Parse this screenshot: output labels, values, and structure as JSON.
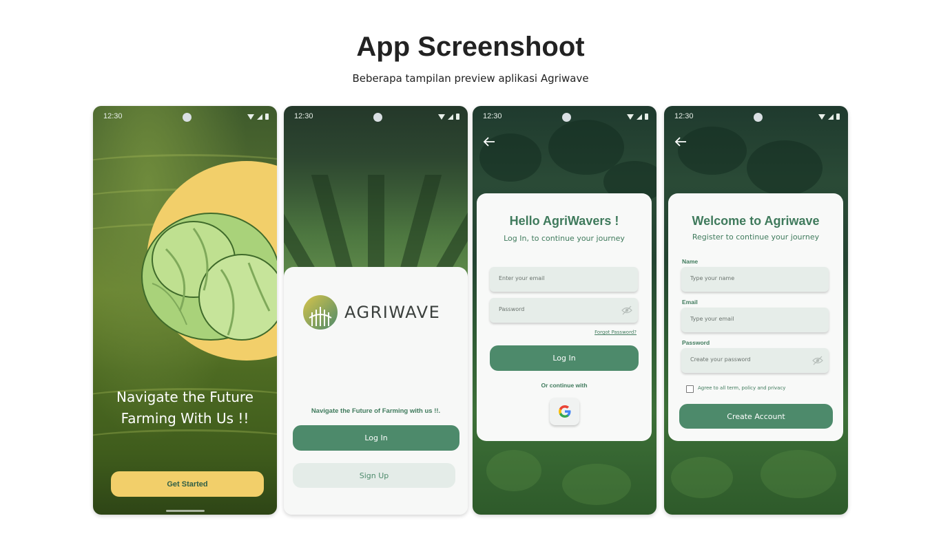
{
  "header": {
    "title": "App Screenshoot",
    "subtitle": "Beberapa tampilan preview aplikasi Agriwave"
  },
  "status_bar": {
    "time": "12:30"
  },
  "screen1": {
    "headline_line1": "Navigate the Future",
    "headline_line2": "Farming With Us !!",
    "get_started": "Get Started"
  },
  "screen2": {
    "logo_text": "AGRIWAVE",
    "tagline": "Navigate the Future of Farming with us !!.",
    "login": "Log In",
    "signup": "Sign Up"
  },
  "screen3": {
    "title": "Hello AgriWavers !",
    "subtitle": "Log In, to continue your journey",
    "email_placeholder": "Enter your email",
    "password_placeholder": "Password",
    "forgot_password": "Forgot Password?",
    "login": "Log In",
    "or_continue": "Or continue with"
  },
  "screen4": {
    "title": "Welcome to Agriwave",
    "subtitle": "Register to continue your journey",
    "name_label": "Name",
    "name_placeholder": "Type your name",
    "email_label": "Email",
    "email_placeholder": "Type your email",
    "password_label": "Password",
    "password_placeholder": "Create your password",
    "agree": "Agree to all term, policy and privacy",
    "create_account": "Create Account"
  },
  "colors": {
    "primary_green": "#4d8a6b",
    "text_green": "#3f7a5c",
    "accent_yellow": "#f2cf6a"
  }
}
